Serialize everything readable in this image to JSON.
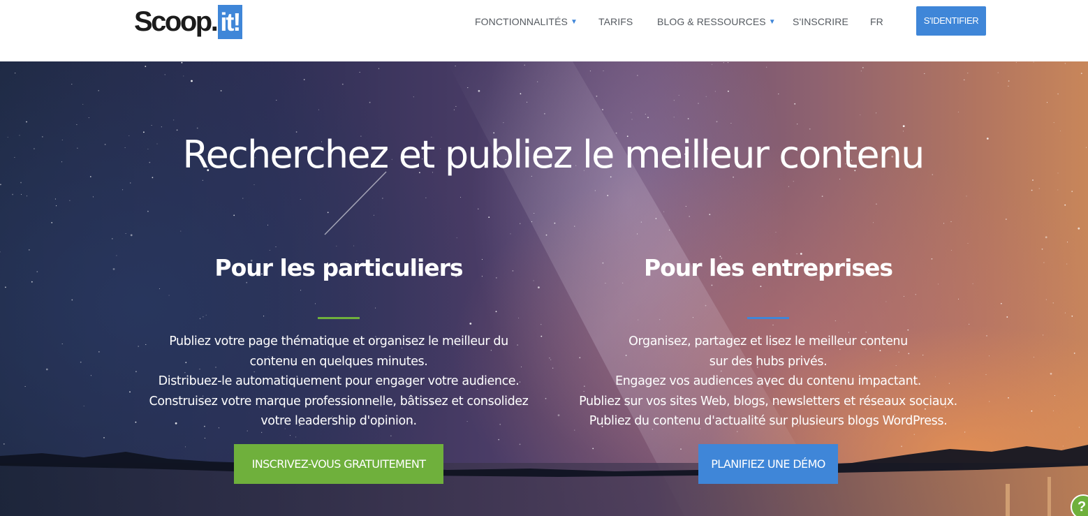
{
  "brand": {
    "logo_text": "Scoop.",
    "logo_badge": "it!",
    "accent_color": "#3f86d8",
    "green_color": "#6fb03c"
  },
  "nav": {
    "items": [
      {
        "label": "FONCTIONNALITÉS",
        "has_dropdown": true
      },
      {
        "label": "TARIFS",
        "has_dropdown": false
      },
      {
        "label": "BLOG & RESSOURCES",
        "has_dropdown": true
      },
      {
        "label": "S'INSCRIRE",
        "has_dropdown": false
      },
      {
        "label": "FR",
        "has_dropdown": false
      }
    ],
    "caret_icon": "▼",
    "login_label": "S'IDENTIFIER"
  },
  "hero": {
    "title": "Recherchez et publiez le meilleur contenu",
    "individuals": {
      "heading": "Pour les particuliers",
      "divider_color": "#6fb03c",
      "lines": [
        "Publiez votre page thématique et organisez le meilleur du",
        "contenu en quelques minutes.",
        "Distribuez-le automatiquement pour engager votre audience.",
        "Construisez votre marque professionnelle, bâtissez et consolidez",
        "votre leadership d'opinion."
      ],
      "cta_label": "INSCRIVEZ-VOUS GRATUITEMENT"
    },
    "businesses": {
      "heading": "Pour les entreprises",
      "divider_color": "#3f86d8",
      "lines": [
        "Organisez, partagez et lisez le meilleur contenu",
        "sur des hubs privés.",
        "Engagez vos audiences avec du contenu impactant.",
        "Publiez sur vos sites Web, blogs, newsletters et réseaux sociaux.",
        "Publiez du contenu d'actualité sur plusieurs blogs WordPress."
      ],
      "cta_label": "PLANIFIEZ UNE DÉMO"
    }
  },
  "help": {
    "icon": "help-icon",
    "glyph": "?"
  }
}
